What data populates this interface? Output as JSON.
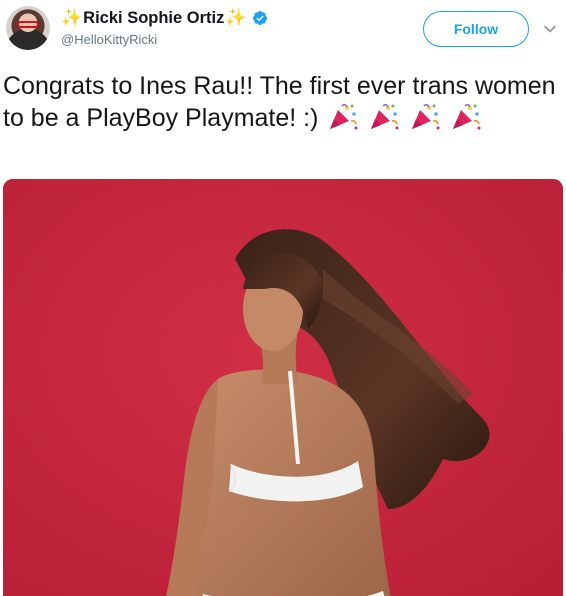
{
  "user": {
    "display_name": "Ricki Sophie Ortiz",
    "sparkle_left": "✨",
    "sparkle_right": "✨",
    "handle": "@HelloKittyRicki",
    "verified": true
  },
  "actions": {
    "follow_label": "Follow"
  },
  "tweet": {
    "text": "Congrats to Ines Rau!! The first ever trans women to be a PlayBoy Playmate! :)",
    "emoji": [
      "party-popper",
      "party-popper",
      "party-popper",
      "party-popper"
    ]
  },
  "media": {
    "description_icon": "photo",
    "background_color": "#c4263d"
  },
  "colors": {
    "accent": "#1aa1f2",
    "secondary_text": "#657786",
    "primary_text": "#14171a"
  }
}
